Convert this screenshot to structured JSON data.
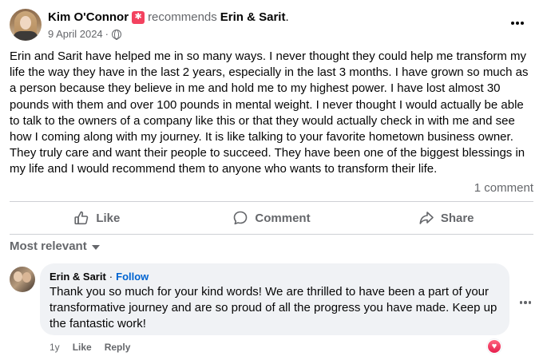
{
  "post": {
    "author": "Kim O'Connor",
    "recommends_text": "recommends",
    "page": "Erin & Sarit",
    "page_suffix": ".",
    "date": "9 April 2024",
    "date_separator": "·",
    "privacy_icon": "globe-icon",
    "body": "Erin and Sarit have helped me in so many ways. I never thought they could help me transform my life the way they have in the last 2 years, especially in the last 3 months. I have grown so much as a person because they believe in me and hold me to my highest power. I have lost almost 30 pounds with them and over 100 pounds in mental weight. I never thought I would actually be able to talk to the owners of a company like this or that they would actually check in with me and see how I coming along with my journey. It is like talking to your favorite hometown business owner. They truly care and want their people to succeed. They have been one of the biggest blessings in my life and I would recommend them to anyone who wants to transform their life.",
    "comment_count": "1 comment"
  },
  "actions": {
    "like": "Like",
    "comment": "Comment",
    "share": "Share"
  },
  "comments_section": {
    "sort_label": "Most relevant",
    "comments": [
      {
        "author": "Erin & Sarit",
        "separator": "·",
        "follow": "Follow",
        "text": "Thank you so much for your kind words! We are thrilled to have been a part of your transformative journey and are so proud of all the progress you have made. Keep up the fantastic work!",
        "time": "1y",
        "like": "Like",
        "reply": "Reply",
        "reaction_icon": "heart-icon"
      }
    ]
  },
  "colors": {
    "accent_blue": "#0064d1",
    "muted": "#65676b",
    "recommend_red": "#f3425f",
    "bubble_bg": "#f0f2f5"
  }
}
